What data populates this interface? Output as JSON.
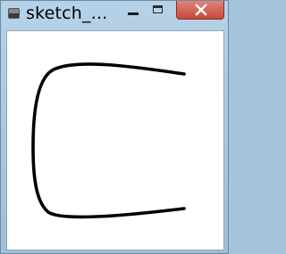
{
  "window": {
    "title": "sketch_...",
    "icon": "app-cube-icon",
    "buttons": {
      "minimize": "minimize-icon",
      "maximize": "maximize-icon",
      "close": "close-icon"
    },
    "close_color": "#c74a3a"
  },
  "canvas": {
    "background": "#ffffff",
    "stroke_color": "#000000"
  }
}
